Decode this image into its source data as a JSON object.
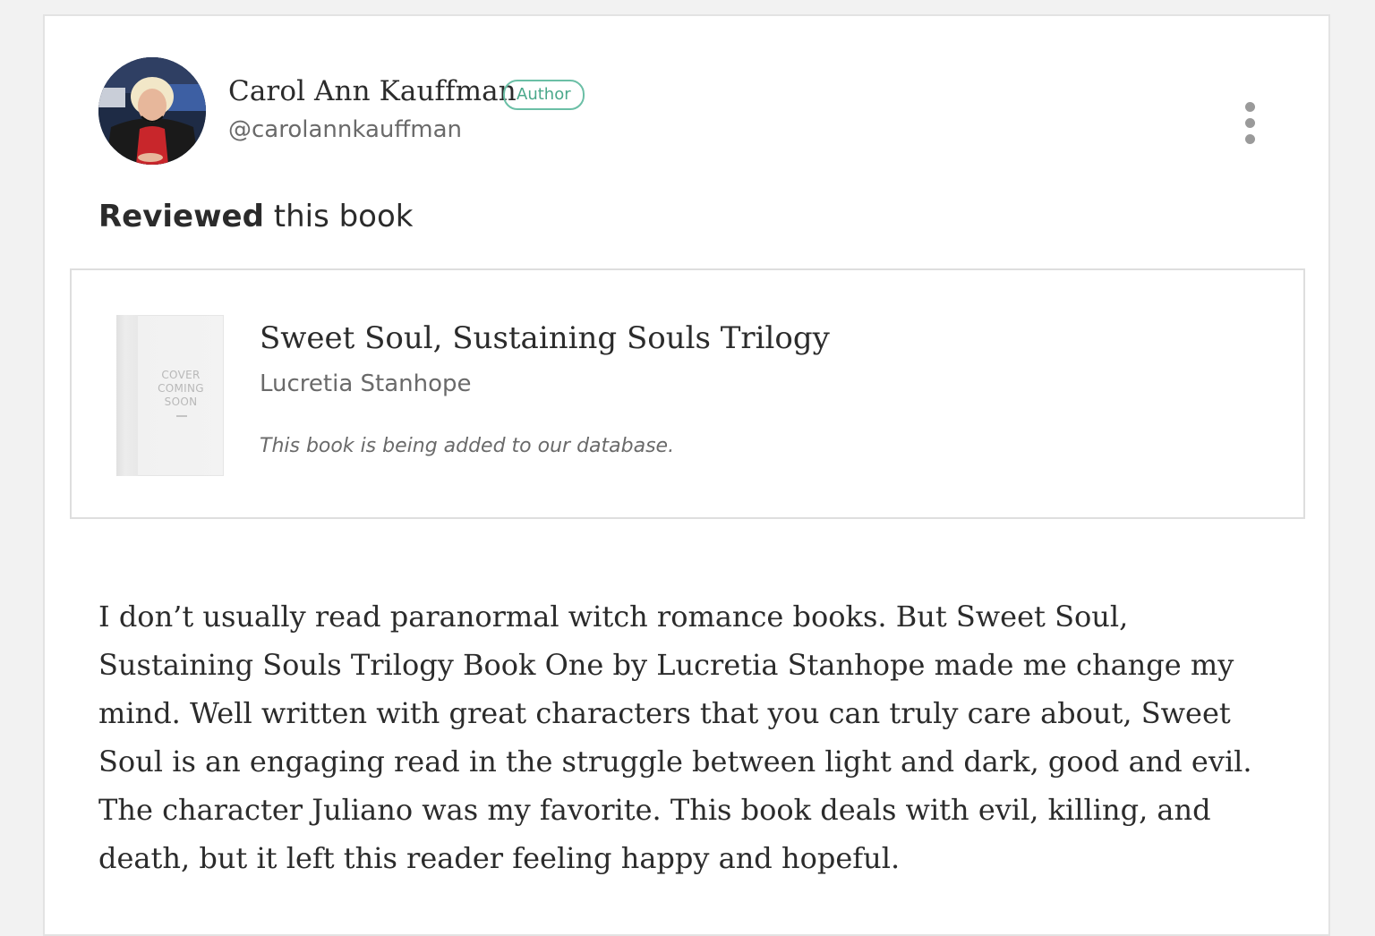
{
  "reviewer": {
    "name": "Carol Ann Kauffman",
    "badge": "Author",
    "handle": "@carolannkauffman",
    "avatar_icon": "person-photo"
  },
  "activity": {
    "verb": "Reviewed",
    "object": " this book"
  },
  "book": {
    "title": "Sweet Soul, Sustaining Souls Trilogy",
    "author": "Lucretia Stanhope",
    "status": "This book is being added to our database.",
    "cover_text": "COVER COMING SOON"
  },
  "review": {
    "text": "I don’t usually read paranormal witch romance books. But Sweet Soul, Sustaining Souls Trilogy Book One by Lucretia Stanhope made me change my mind. Well written with great characters that you can truly care about, Sweet Soul is an engaging read in the struggle between light and dark, good and evil. The character Juliano was my favorite. This book deals with evil, killing, and death, but it left this reader feeling happy and hopeful."
  },
  "menu": {
    "icon": "more-vertical-icon"
  },
  "colors": {
    "badge": "#4aa88b",
    "background": "#f2f2f2",
    "card": "#ffffff",
    "text": "#2b2b2b",
    "muted": "#6a6a6a"
  }
}
